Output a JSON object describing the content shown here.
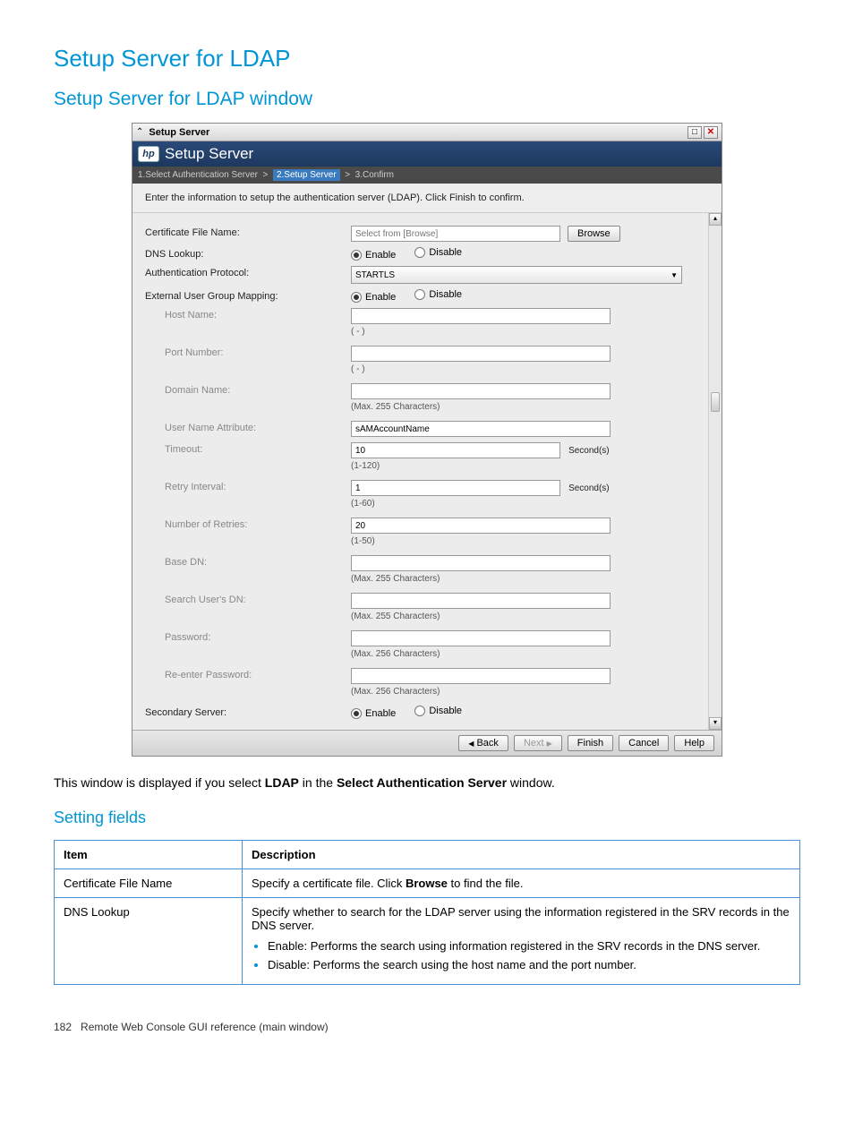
{
  "page": {
    "h1": "Setup Server for LDAP",
    "h2": "Setup Server for LDAP window",
    "h3": "Setting fields",
    "footer_page": "182",
    "footer_text": "Remote Web Console GUI reference (main window)"
  },
  "window": {
    "titlebar": "Setup Server",
    "banner": "Setup Server",
    "breadcrumb": {
      "step1": "1.Select Authentication Server",
      "sep": ">",
      "step2": "2.Setup Server",
      "step3": "3.Confirm"
    },
    "instruction": "Enter the information to setup the authentication server (LDAP). Click Finish to confirm."
  },
  "form": {
    "cert_label": "Certificate File Name:",
    "cert_placeholder": "Select from [Browse]",
    "browse": "Browse",
    "dns_label": "DNS Lookup:",
    "enable": "Enable",
    "disable": "Disable",
    "auth_label": "Authentication Protocol:",
    "auth_value": "STARTLS",
    "ext_label": "External User Group Mapping:",
    "host_label": "Host Name:",
    "host_hint": "( - )",
    "port_label": "Port Number:",
    "port_hint": "( - )",
    "domain_label": "Domain Name:",
    "max255": "(Max. 255 Characters)",
    "max256": "(Max. 256 Characters)",
    "userattr_label": "User Name Attribute:",
    "userattr_value": "sAMAccountName",
    "timeout_label": "Timeout:",
    "timeout_value": "10",
    "timeout_hint": "(1-120)",
    "seconds": "Second(s)",
    "retry_label": "Retry Interval:",
    "retry_value": "1",
    "retry_hint": "(1-60)",
    "numretries_label": "Number of Retries:",
    "numretries_value": "20",
    "numretries_hint": "(1-50)",
    "basedn_label": "Base DN:",
    "searchdn_label": "Search User's DN:",
    "password_label": "Password:",
    "repassword_label": "Re-enter Password:",
    "secondary_label": "Secondary Server:"
  },
  "buttons": {
    "back": "Back",
    "next": "Next",
    "finish": "Finish",
    "cancel": "Cancel",
    "help": "Help"
  },
  "doc": {
    "intro_pre": "This window is displayed if you select ",
    "intro_bold1": "LDAP",
    "intro_mid": " in the ",
    "intro_bold2": "Select Authentication Server",
    "intro_post": " window."
  },
  "table": {
    "head_item": "Item",
    "head_desc": "Description",
    "rows": [
      {
        "item": "Certificate File Name",
        "desc_pre": "Specify a certificate file. Click ",
        "desc_bold": "Browse",
        "desc_post": " to find the file."
      },
      {
        "item": "DNS Lookup",
        "desc": "Specify whether to search for the LDAP server using the information registered in the SRV records in the DNS server.",
        "bullets": [
          "Enable: Performs the search using information registered in the SRV records in the DNS server.",
          "Disable: Performs the search using the host name and the port number."
        ]
      }
    ]
  }
}
